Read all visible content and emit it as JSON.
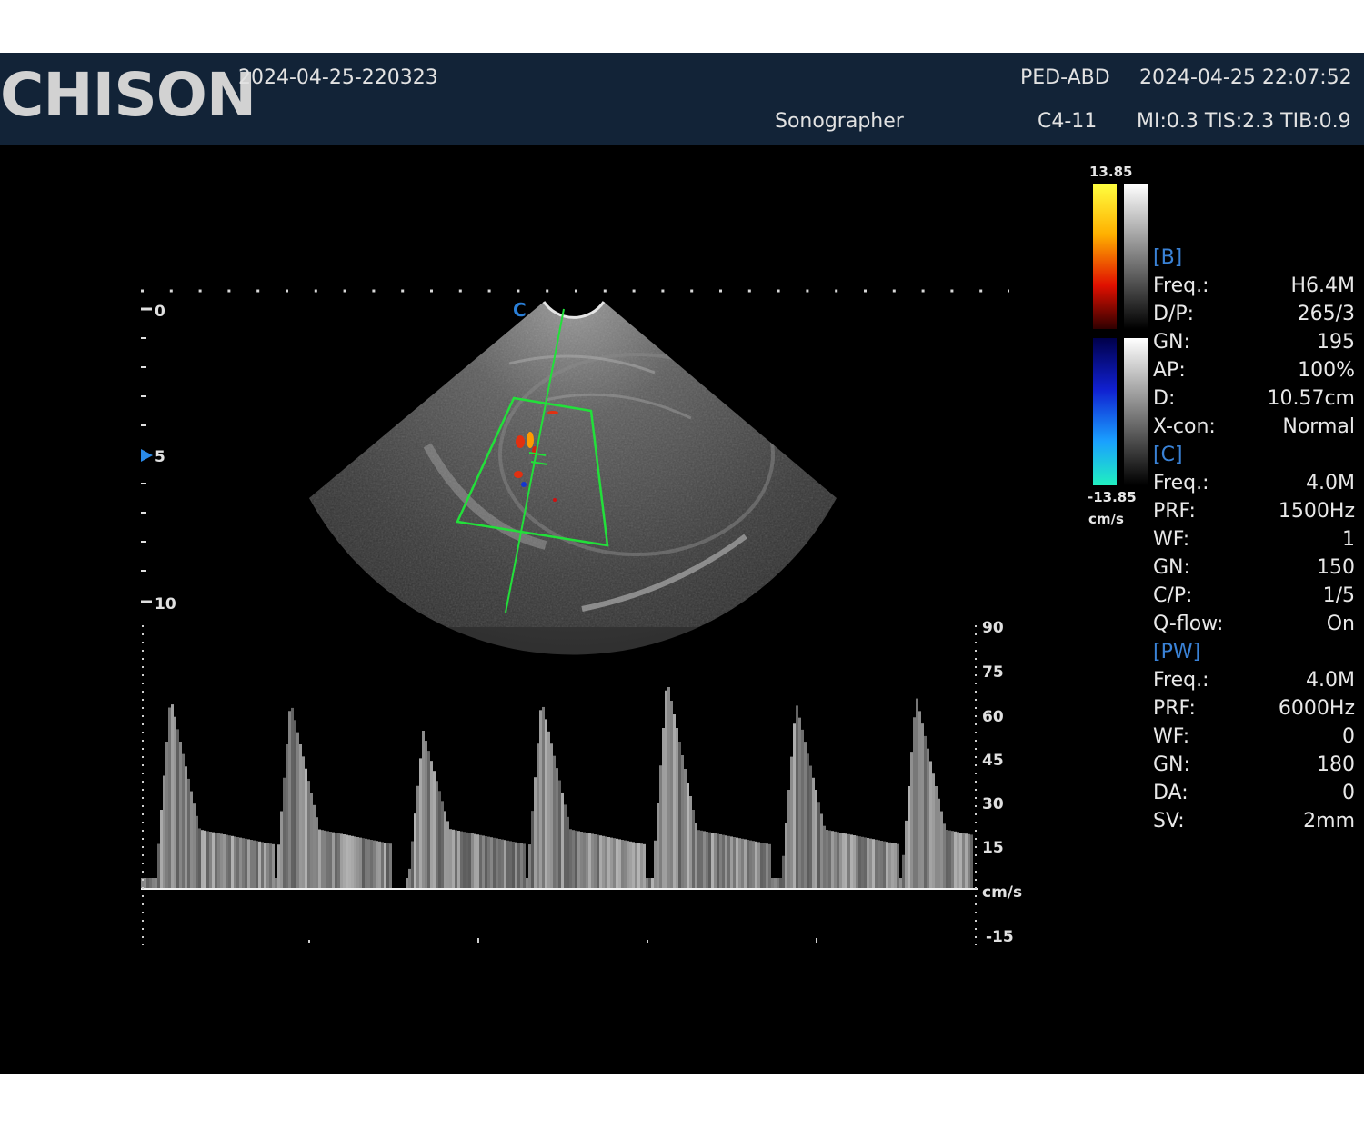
{
  "header": {
    "logo": "CHISON",
    "exam_id": "2024-04-25-220323",
    "preset": "PED-ABD",
    "datetime": "2024-04-25 22:07:52",
    "operator": "Sonographer",
    "probe": "C4-11",
    "indices": "MI:0.3 TIS:2.3 TIB:0.9"
  },
  "depth_scale": {
    "labels": [
      "0",
      "5",
      "10"
    ],
    "focus_marker": "5"
  },
  "orientation_mark": "C",
  "color_bar": {
    "max": "13.85",
    "min": "-13.85",
    "unit": "cm/s"
  },
  "doppler": {
    "velocity_labels": [
      "90",
      "75",
      "60",
      "45",
      "30",
      "15",
      "cm/s",
      "-15"
    ],
    "unit": "cm/s"
  },
  "params": {
    "b_title": "[B]",
    "b": [
      {
        "k": "Freq.:",
        "v": "H6.4M"
      },
      {
        "k": "D/P:",
        "v": "265/3"
      },
      {
        "k": "GN:",
        "v": "195"
      },
      {
        "k": "AP:",
        "v": "100%"
      },
      {
        "k": "D:",
        "v": "10.57cm"
      },
      {
        "k": "X-con:",
        "v": "Normal"
      }
    ],
    "c_title": "[C]",
    "c": [
      {
        "k": "Freq.:",
        "v": "4.0M"
      },
      {
        "k": "PRF:",
        "v": "1500Hz"
      },
      {
        "k": "WF:",
        "v": "1"
      },
      {
        "k": "GN:",
        "v": "150"
      },
      {
        "k": "C/P:",
        "v": "1/5"
      },
      {
        "k": "Q-flow:",
        "v": "On"
      }
    ],
    "pw_title": "[PW]",
    "pw": [
      {
        "k": "Freq.:",
        "v": "4.0M"
      },
      {
        "k": "PRF:",
        "v": "6000Hz"
      },
      {
        "k": "WF:",
        "v": "0"
      },
      {
        "k": "GN:",
        "v": "180"
      },
      {
        "k": "DA:",
        "v": "0"
      },
      {
        "k": "SV:",
        "v": "2mm"
      }
    ]
  },
  "colors": {
    "header_bg": "#122337",
    "screen_bg": "#000000",
    "roi_green": "#22e03a",
    "section_blue": "#3a82d6"
  }
}
